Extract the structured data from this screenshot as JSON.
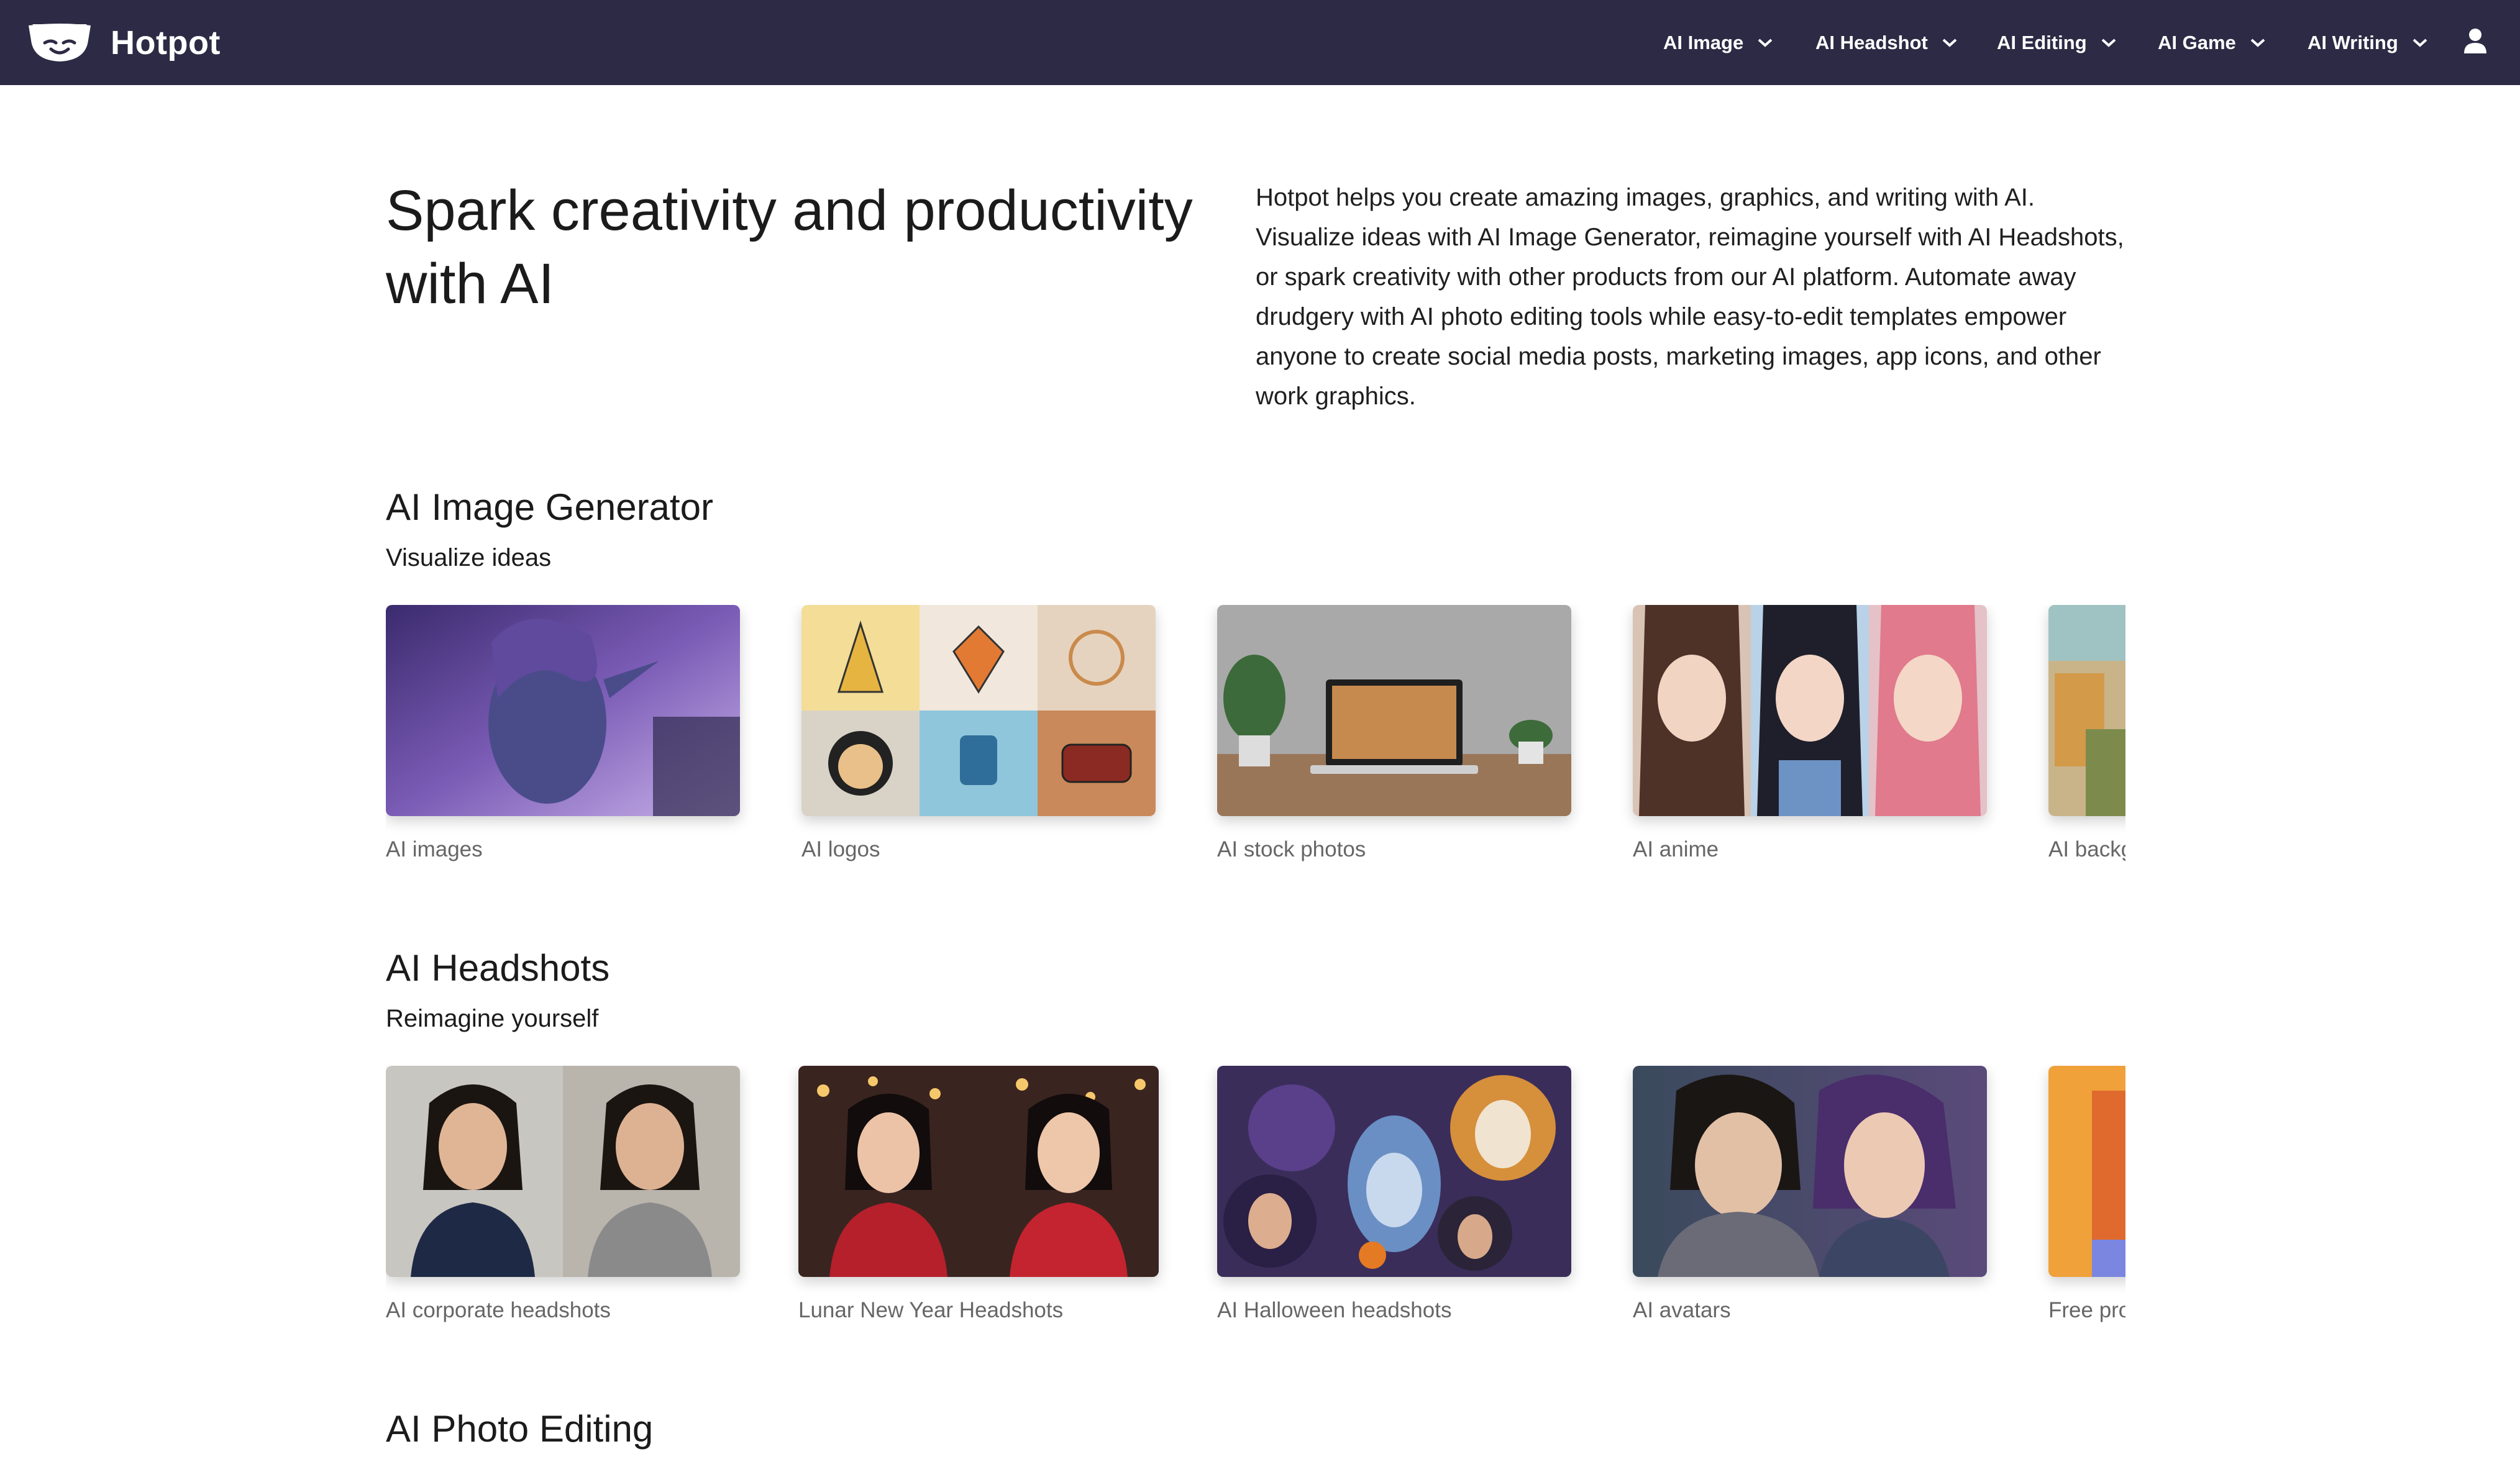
{
  "header": {
    "brand_name": "Hotpot",
    "nav": [
      {
        "label": "AI Image"
      },
      {
        "label": "AI Headshot"
      },
      {
        "label": "AI Editing"
      },
      {
        "label": "AI Game"
      },
      {
        "label": "AI Writing"
      }
    ],
    "background_color": "#2c2a44"
  },
  "hero": {
    "title": "Spark creativity and productivity with AI",
    "description": "Hotpot helps you create amazing images, graphics, and writing with AI. Visualize ideas with AI Image Generator, reimagine yourself with AI Headshots, or spark creativity with other products from our AI platform. Automate away drudgery with AI photo editing tools while easy-to-edit templates empower anyone to create social media posts, marketing images, app icons, and other work graphics."
  },
  "sections": [
    {
      "title": "AI Image Generator",
      "subtitle": "Visualize ideas",
      "cards": [
        {
          "label": "AI images",
          "image": "purple-elf-portrait"
        },
        {
          "label": "AI logos",
          "image": "logo-grid"
        },
        {
          "label": "AI stock photos",
          "image": "laptop-desk"
        },
        {
          "label": "AI anime",
          "image": "anime-girls"
        },
        {
          "label": "AI backgrounds",
          "image": "town-landscape"
        }
      ]
    },
    {
      "title": "AI Headshots",
      "subtitle": "Reimagine yourself",
      "cards": [
        {
          "label": "AI corporate headshots",
          "image": "corporate-headshots"
        },
        {
          "label": "Lunar New Year Headshots",
          "image": "lunar-new-year"
        },
        {
          "label": "AI Halloween headshots",
          "image": "halloween-collage"
        },
        {
          "label": "AI avatars",
          "image": "fantasy-avatars"
        },
        {
          "label": "Free profile pictures",
          "image": "orange-gradient"
        }
      ]
    },
    {
      "title": "AI Photo Editing"
    }
  ]
}
